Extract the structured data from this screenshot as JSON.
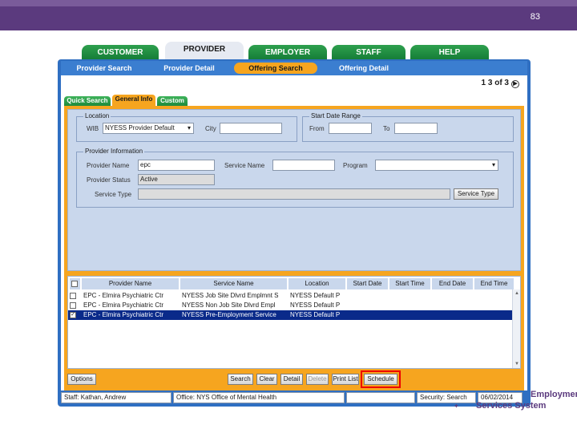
{
  "slide": {
    "number": "83"
  },
  "main_tabs": [
    {
      "label": "CUSTOMER"
    },
    {
      "label": "PROVIDER"
    },
    {
      "label": "EMPLOYER"
    },
    {
      "label": "STAFF"
    },
    {
      "label": "HELP"
    }
  ],
  "sub_nav": [
    {
      "label": "Provider Search"
    },
    {
      "label": "Provider Detail"
    },
    {
      "label": "Offering Search"
    },
    {
      "label": "Offering Detail"
    }
  ],
  "pager": {
    "text": "1 3 of 3"
  },
  "form_tabs": [
    {
      "label": "Quick Search"
    },
    {
      "label": "General Info"
    },
    {
      "label": "Custom"
    }
  ],
  "location": {
    "legend": "Location",
    "wib_label": "WIB",
    "wib_value": "NYESS Provider Default",
    "city_label": "City",
    "city_value": ""
  },
  "start_date_range": {
    "legend": "Start Date Range",
    "from_label": "From",
    "from_value": "",
    "to_label": "To",
    "to_value": ""
  },
  "provider_info": {
    "legend": "Provider Information",
    "provider_name_label": "Provider Name",
    "provider_name_value": "epc",
    "service_name_label": "Service Name",
    "service_name_value": "",
    "program_label": "Program",
    "program_value": "",
    "provider_status_label": "Provider Status",
    "provider_status_value": "Active",
    "service_type_label": "Service Type",
    "service_type_value": "",
    "service_type_button": "Service Type"
  },
  "grid": {
    "columns": [
      "Provider Name",
      "Service Name",
      "Location",
      "Start Date",
      "Start Time",
      "End Date",
      "End Time"
    ],
    "rows": [
      {
        "checked": false,
        "provider": "EPC - Elmira Psychiatric Ctr",
        "service": "NYESS Job Site Dlvrd Emplmnt S",
        "location": "NYESS Default P",
        "selected": false
      },
      {
        "checked": false,
        "provider": "EPC - Elmira Psychiatric Ctr",
        "service": "NYESS Non Job Site Dlvrd Empl",
        "location": "NYESS Default P",
        "selected": false
      },
      {
        "checked": true,
        "provider": "EPC - Elmira Psychiatric Ctr",
        "service": "NYESS Pre-Employment Service",
        "location": "NYESS Default P",
        "selected": true
      }
    ],
    "check_mark": "✓"
  },
  "actions": {
    "options": "Options",
    "search": "Search",
    "clear": "Clear",
    "detail": "Detail",
    "delete": "Delete",
    "print_list": "Print List",
    "schedule": "Schedule"
  },
  "status_bar": {
    "staff": "Staff: Kathan, Andrew",
    "office": "Office: NYS Office of Mental Health",
    "empty": "",
    "security": "Security: Search",
    "date": "06/02/2014"
  },
  "logo": {
    "line1": "Employment",
    "line2": "Services System"
  },
  "colors": {
    "brand": "#5b3a7e",
    "tab_green": "#2ea04e",
    "frame_blue": "#2f6fc2",
    "accent_orange": "#f6a51f",
    "highlight_red": "#ee0000",
    "selection": "#0a2a8a"
  }
}
